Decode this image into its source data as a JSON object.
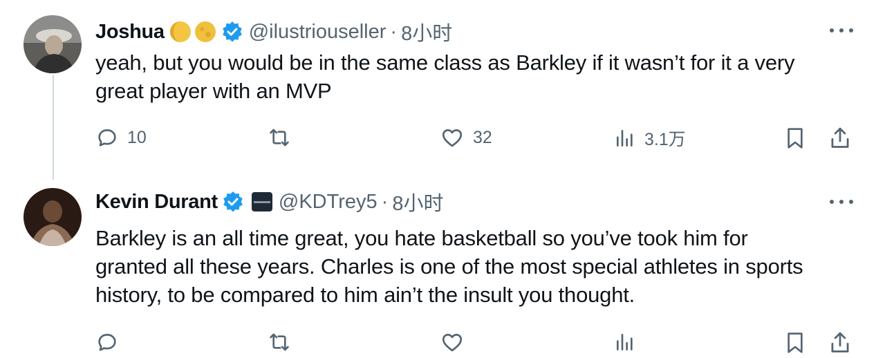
{
  "posts": [
    {
      "author": "Joshua",
      "handle": "@ilustriouseller",
      "separator": "·",
      "time": "8小时",
      "text_lines": [
        "yeah, but you would be in the same class as Barkley if it wasn’t for it a very",
        "great player with an MVP"
      ],
      "actions": {
        "replies": "10",
        "reposts": "",
        "likes": "32",
        "views": "3.1万"
      }
    },
    {
      "author": "Kevin Durant",
      "handle": "@KDTrey5",
      "separator": "·",
      "time": "8小时",
      "text_lines": [
        "Barkley is an all time great, you hate basketball so you’ve took him for",
        "granted all these years. Charles is one of the most special athletes in sports",
        "history, to be compared to him ain’t the insult you thought."
      ],
      "actions": {
        "replies": "",
        "reposts": "",
        "likes": "",
        "views": ""
      }
    }
  ],
  "colors": {
    "verified": "#1d9bf0",
    "muted": "#536471",
    "text": "#0f1419"
  }
}
